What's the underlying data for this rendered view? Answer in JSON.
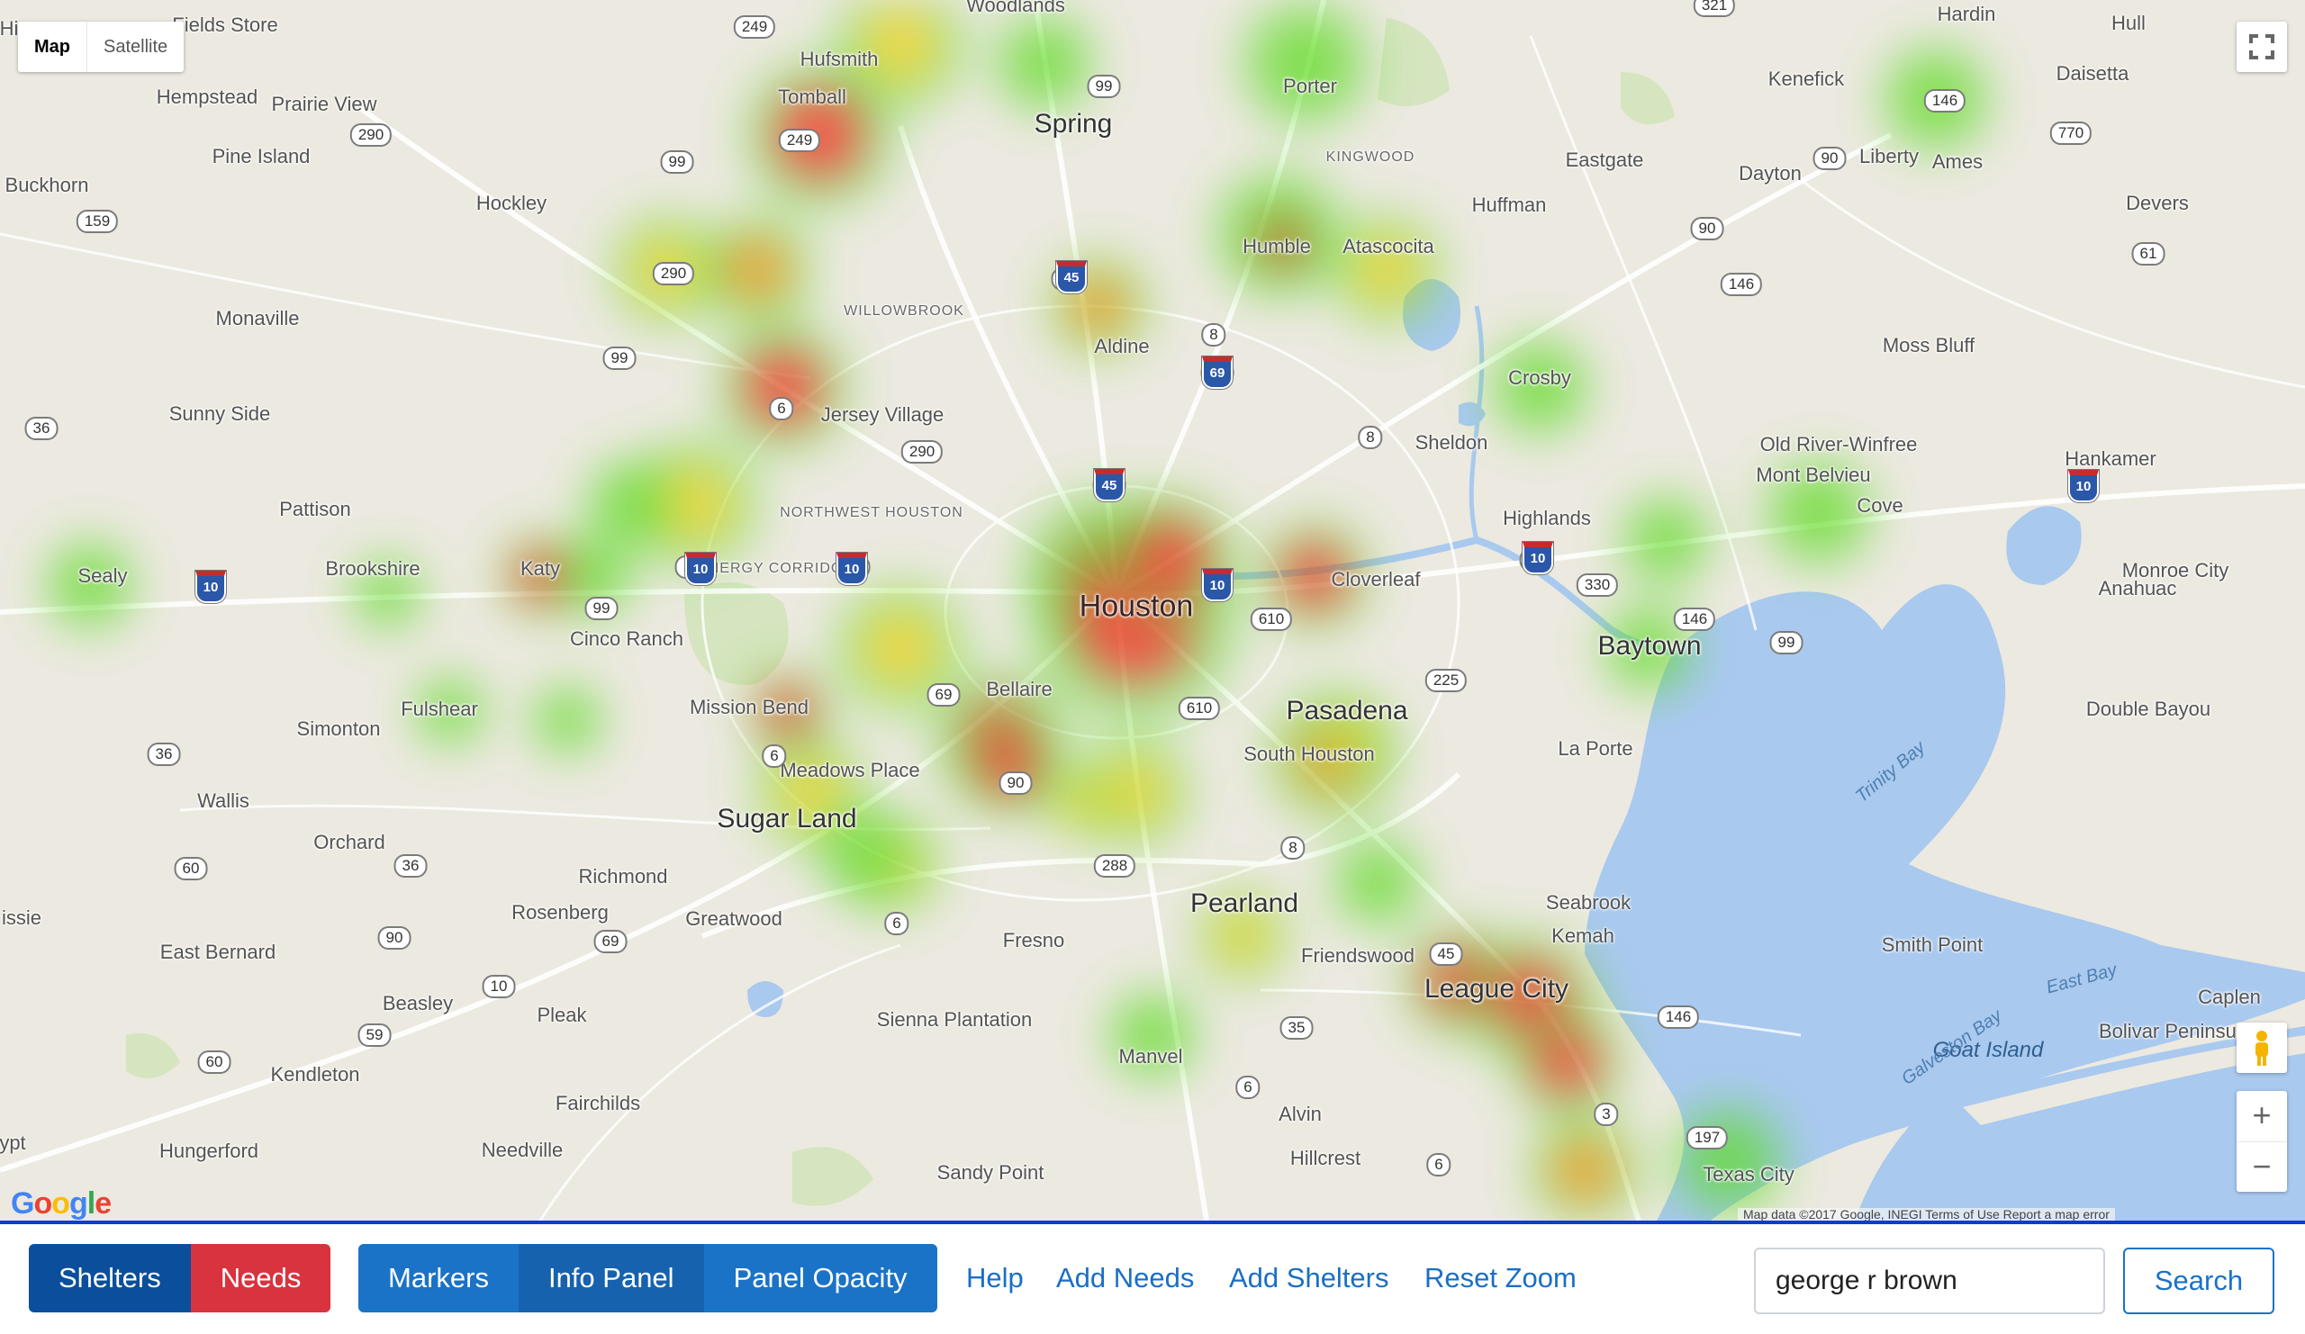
{
  "map": {
    "map_type_control": {
      "map_label": "Map",
      "satellite_label": "Satellite"
    },
    "google_logo": "Google",
    "attribution": "Map data ©2017 Google, INEGI   Terms of Use   Report a map error",
    "place_labels": [
      {
        "text": "Fields Store"
      },
      {
        "text": "Hufsmith"
      },
      {
        "text": "Woodlands"
      },
      {
        "text": "Porter"
      },
      {
        "text": "Hardin"
      },
      {
        "text": "Hull"
      },
      {
        "text": "Hempstead"
      },
      {
        "text": "Prairie View"
      },
      {
        "text": "Tomball"
      },
      {
        "text": "Spring"
      },
      {
        "text": "Kenefick"
      },
      {
        "text": "Daisetta"
      },
      {
        "text": "Pine Island"
      },
      {
        "text": "Kingwood"
      },
      {
        "text": "Eastgate"
      },
      {
        "text": "Dayton"
      },
      {
        "text": "Liberty"
      },
      {
        "text": "Ames"
      },
      {
        "text": "Buckhorn"
      },
      {
        "text": "Hockley"
      },
      {
        "text": "Huffman"
      },
      {
        "text": "Devers"
      },
      {
        "text": "Humble"
      },
      {
        "text": "Atascocita"
      },
      {
        "text": "Willowbrook"
      },
      {
        "text": "Monaville"
      },
      {
        "text": "Aldine"
      },
      {
        "text": "Moss Bluff"
      },
      {
        "text": "Crosby"
      },
      {
        "text": "Sunny Side"
      },
      {
        "text": "Jersey Village"
      },
      {
        "text": "Sheldon"
      },
      {
        "text": "Old River-Winfree"
      },
      {
        "text": "Hankamer"
      },
      {
        "text": "Mont Belvieu"
      },
      {
        "text": "Cove"
      },
      {
        "text": "Pattison"
      },
      {
        "text": "Northwest Houston"
      },
      {
        "text": "Highlands"
      },
      {
        "text": "Sealy"
      },
      {
        "text": "Brookshire"
      },
      {
        "text": "Katy"
      },
      {
        "text": "Energy Corridor"
      },
      {
        "text": "Houston"
      },
      {
        "text": "Cloverleaf"
      },
      {
        "text": "Monroe City"
      },
      {
        "text": "Anahuac"
      },
      {
        "text": "Cinco Ranch"
      },
      {
        "text": "Baytown"
      },
      {
        "text": "Bellaire"
      },
      {
        "text": "Pasadena"
      },
      {
        "text": "Fulshear"
      },
      {
        "text": "Mission Bend"
      },
      {
        "text": "Simonton"
      },
      {
        "text": "Double Bayou"
      },
      {
        "text": "La Porte"
      },
      {
        "text": "South Houston"
      },
      {
        "text": "Meadows Place"
      },
      {
        "text": "Wallis"
      },
      {
        "text": "Sugar Land"
      },
      {
        "text": "Orchard"
      },
      {
        "text": "Pearland"
      },
      {
        "text": "Richmond"
      },
      {
        "text": "Seabrook"
      },
      {
        "text": "Rosenberg"
      },
      {
        "text": "Greatwood"
      },
      {
        "text": "Kemah"
      },
      {
        "text": "Fresno"
      },
      {
        "text": "Smith Point"
      },
      {
        "text": "East Bernard"
      },
      {
        "text": "Friendswood"
      },
      {
        "text": "League City"
      },
      {
        "text": "Beasley"
      },
      {
        "text": "Pleak"
      },
      {
        "text": "Sienna Plantation"
      },
      {
        "text": "Bolivar Peninsula"
      },
      {
        "text": "Caplen"
      },
      {
        "text": "Goat Island"
      },
      {
        "text": "Kendleton"
      },
      {
        "text": "Manvel"
      },
      {
        "text": "Fairchilds"
      },
      {
        "text": "Alvin"
      },
      {
        "text": "Hungerford"
      },
      {
        "text": "Needville"
      },
      {
        "text": "Hillcrest"
      },
      {
        "text": "Sandy Point"
      },
      {
        "text": "Texas City"
      },
      {
        "text": "Trinity Bay"
      },
      {
        "text": "East Bay"
      },
      {
        "text": "Galveston Bay"
      },
      {
        "text": "Hi"
      },
      {
        "text": "issie"
      },
      {
        "text": "ypt"
      }
    ],
    "road_shields": [
      "249",
      "99",
      "290",
      "99",
      "321",
      "146",
      "90",
      "770",
      "90",
      "146",
      "61",
      "99",
      "159",
      "290",
      "249",
      "45",
      "8",
      "69",
      "36",
      "6",
      "290",
      "8",
      "45",
      "10",
      "10",
      "10",
      "330",
      "146",
      "99",
      "225",
      "69",
      "610",
      "610",
      "99",
      "36",
      "6",
      "90",
      "8",
      "288",
      "60",
      "36",
      "90",
      "6",
      "69",
      "10",
      "59",
      "35",
      "60",
      "6",
      "6",
      "3",
      "197",
      "45",
      "146"
    ],
    "interstate_shields": [
      "10",
      "10",
      "10",
      "10",
      "10",
      "45",
      "69",
      "45",
      "10"
    ],
    "heatmap_points": [
      {
        "intensity": 0.55
      },
      {
        "intensity": 0.35
      },
      {
        "intensity": 0.45
      },
      {
        "intensity": 0.9
      },
      {
        "intensity": 0.75
      },
      {
        "intensity": 0.7
      },
      {
        "intensity": 0.6
      },
      {
        "intensity": 0.85
      },
      {
        "intensity": 0.45
      },
      {
        "intensity": 0.5
      },
      {
        "intensity": 0.35
      },
      {
        "intensity": 0.9
      },
      {
        "intensity": 0.6
      },
      {
        "intensity": 0.45
      },
      {
        "intensity": 0.4
      },
      {
        "intensity": 0.4
      },
      {
        "intensity": 0.35
      },
      {
        "intensity": 0.85
      },
      {
        "intensity": 0.95
      },
      {
        "intensity": 1.0
      },
      {
        "intensity": 0.95
      },
      {
        "intensity": 0.95
      },
      {
        "intensity": 0.9
      },
      {
        "intensity": 0.6
      },
      {
        "intensity": 0.55
      },
      {
        "intensity": 0.85
      },
      {
        "intensity": 0.9
      },
      {
        "intensity": 0.55
      },
      {
        "intensity": 0.5
      },
      {
        "intensity": 0.7
      },
      {
        "intensity": 0.6
      },
      {
        "intensity": 0.4
      },
      {
        "intensity": 0.35
      },
      {
        "intensity": 0.5
      },
      {
        "intensity": 0.5
      },
      {
        "intensity": 0.45
      },
      {
        "intensity": 0.95
      },
      {
        "intensity": 0.9
      },
      {
        "intensity": 0.85
      },
      {
        "intensity": 0.75
      },
      {
        "intensity": 0.4
      },
      {
        "intensity": 0.4
      },
      {
        "intensity": 0.35
      },
      {
        "intensity": 0.45
      },
      {
        "intensity": 0.4
      },
      {
        "intensity": 0.35
      },
      {
        "intensity": 0.35
      }
    ],
    "zoom_in_label": "+",
    "zoom_out_label": "−"
  },
  "toolbar": {
    "shelters_label": "Shelters",
    "needs_label": "Needs",
    "markers_label": "Markers",
    "info_panel_label": "Info Panel",
    "panel_opacity_label": "Panel Opacity",
    "help_label": "Help",
    "add_needs_label": "Add Needs",
    "add_shelters_label": "Add Shelters",
    "reset_zoom_label": "Reset Zoom",
    "search_value": "george r brown",
    "search_button_label": "Search"
  },
  "colors": {
    "shelters_bg": "#0b4f9c",
    "needs_bg": "#d9333f",
    "primary_bg": "#1a73c6",
    "primary_active_bg": "#1662ae",
    "link_color": "#1a6fc4",
    "toolbar_border": "#0d3bd6",
    "water": "#a9c9ef",
    "land": "#ece9e0"
  }
}
